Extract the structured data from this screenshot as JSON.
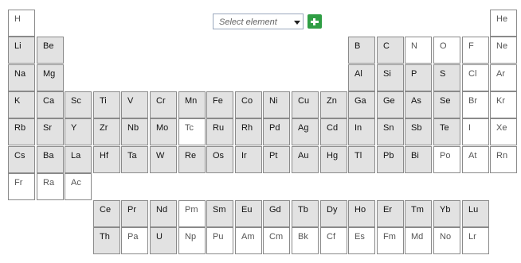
{
  "selector": {
    "placeholder": "Select element",
    "add_icon": "plus-icon",
    "accent_color": "#2f9e44"
  },
  "elements": [
    {
      "symbol": "H",
      "selected": false
    },
    {
      "symbol": "He",
      "selected": false
    },
    {
      "symbol": "Li",
      "selected": true
    },
    {
      "symbol": "Be",
      "selected": true
    },
    {
      "symbol": "B",
      "selected": true
    },
    {
      "symbol": "C",
      "selected": true
    },
    {
      "symbol": "N",
      "selected": false
    },
    {
      "symbol": "O",
      "selected": false
    },
    {
      "symbol": "F",
      "selected": false
    },
    {
      "symbol": "Ne",
      "selected": false
    },
    {
      "symbol": "Na",
      "selected": true
    },
    {
      "symbol": "Mg",
      "selected": true
    },
    {
      "symbol": "Al",
      "selected": true
    },
    {
      "symbol": "Si",
      "selected": true
    },
    {
      "symbol": "P",
      "selected": true
    },
    {
      "symbol": "S",
      "selected": true
    },
    {
      "symbol": "Cl",
      "selected": false
    },
    {
      "symbol": "Ar",
      "selected": false
    },
    {
      "symbol": "K",
      "selected": true
    },
    {
      "symbol": "Ca",
      "selected": true
    },
    {
      "symbol": "Sc",
      "selected": true
    },
    {
      "symbol": "Ti",
      "selected": true
    },
    {
      "symbol": "V",
      "selected": true
    },
    {
      "symbol": "Cr",
      "selected": true
    },
    {
      "symbol": "Mn",
      "selected": true
    },
    {
      "symbol": "Fe",
      "selected": true
    },
    {
      "symbol": "Co",
      "selected": true
    },
    {
      "symbol": "Ni",
      "selected": true
    },
    {
      "symbol": "Cu",
      "selected": true
    },
    {
      "symbol": "Zn",
      "selected": true
    },
    {
      "symbol": "Ga",
      "selected": true
    },
    {
      "symbol": "Ge",
      "selected": true
    },
    {
      "symbol": "As",
      "selected": true
    },
    {
      "symbol": "Se",
      "selected": true
    },
    {
      "symbol": "Br",
      "selected": false
    },
    {
      "symbol": "Kr",
      "selected": false
    },
    {
      "symbol": "Rb",
      "selected": true
    },
    {
      "symbol": "Sr",
      "selected": true
    },
    {
      "symbol": "Y",
      "selected": true
    },
    {
      "symbol": "Zr",
      "selected": true
    },
    {
      "symbol": "Nb",
      "selected": true
    },
    {
      "symbol": "Mo",
      "selected": true
    },
    {
      "symbol": "Tc",
      "selected": false
    },
    {
      "symbol": "Ru",
      "selected": true
    },
    {
      "symbol": "Rh",
      "selected": true
    },
    {
      "symbol": "Pd",
      "selected": true
    },
    {
      "symbol": "Ag",
      "selected": true
    },
    {
      "symbol": "Cd",
      "selected": true
    },
    {
      "symbol": "In",
      "selected": true
    },
    {
      "symbol": "Sn",
      "selected": true
    },
    {
      "symbol": "Sb",
      "selected": true
    },
    {
      "symbol": "Te",
      "selected": true
    },
    {
      "symbol": "I",
      "selected": false
    },
    {
      "symbol": "Xe",
      "selected": false
    },
    {
      "symbol": "Cs",
      "selected": true
    },
    {
      "symbol": "Ba",
      "selected": true
    },
    {
      "symbol": "La",
      "selected": true
    },
    {
      "symbol": "Hf",
      "selected": true
    },
    {
      "symbol": "Ta",
      "selected": true
    },
    {
      "symbol": "W",
      "selected": true
    },
    {
      "symbol": "Re",
      "selected": true
    },
    {
      "symbol": "Os",
      "selected": true
    },
    {
      "symbol": "Ir",
      "selected": true
    },
    {
      "symbol": "Pt",
      "selected": true
    },
    {
      "symbol": "Au",
      "selected": true
    },
    {
      "symbol": "Hg",
      "selected": true
    },
    {
      "symbol": "Tl",
      "selected": true
    },
    {
      "symbol": "Pb",
      "selected": true
    },
    {
      "symbol": "Bi",
      "selected": true
    },
    {
      "symbol": "Po",
      "selected": false
    },
    {
      "symbol": "At",
      "selected": false
    },
    {
      "symbol": "Rn",
      "selected": false
    },
    {
      "symbol": "Fr",
      "selected": false
    },
    {
      "symbol": "Ra",
      "selected": false
    },
    {
      "symbol": "Ac",
      "selected": false
    },
    {
      "symbol": "Ce",
      "selected": true
    },
    {
      "symbol": "Pr",
      "selected": true
    },
    {
      "symbol": "Nd",
      "selected": true
    },
    {
      "symbol": "Pm",
      "selected": false
    },
    {
      "symbol": "Sm",
      "selected": true
    },
    {
      "symbol": "Eu",
      "selected": true
    },
    {
      "symbol": "Gd",
      "selected": true
    },
    {
      "symbol": "Tb",
      "selected": true
    },
    {
      "symbol": "Dy",
      "selected": true
    },
    {
      "symbol": "Ho",
      "selected": true
    },
    {
      "symbol": "Er",
      "selected": true
    },
    {
      "symbol": "Tm",
      "selected": true
    },
    {
      "symbol": "Yb",
      "selected": true
    },
    {
      "symbol": "Lu",
      "selected": true
    },
    {
      "symbol": "Th",
      "selected": true
    },
    {
      "symbol": "Pa",
      "selected": false
    },
    {
      "symbol": "U",
      "selected": true
    },
    {
      "symbol": "Np",
      "selected": false
    },
    {
      "symbol": "Pu",
      "selected": false
    },
    {
      "symbol": "Am",
      "selected": false
    },
    {
      "symbol": "Cm",
      "selected": false
    },
    {
      "symbol": "Bk",
      "selected": false
    },
    {
      "symbol": "Cf",
      "selected": false
    },
    {
      "symbol": "Es",
      "selected": false
    },
    {
      "symbol": "Fm",
      "selected": false
    },
    {
      "symbol": "Md",
      "selected": false
    },
    {
      "symbol": "No",
      "selected": false
    },
    {
      "symbol": "Lr",
      "selected": false
    }
  ]
}
